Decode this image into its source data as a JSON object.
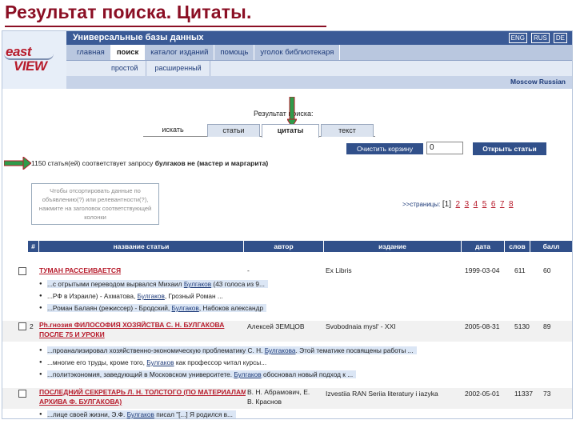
{
  "slide": {
    "title": "Результат поиска. Цитаты."
  },
  "site": {
    "title": "Универсальные базы данных",
    "logo_top": "east",
    "logo_bottom": "VIEW",
    "langs": [
      "ENG",
      "RUS",
      "DE"
    ],
    "nav": [
      "главная",
      "поиск",
      "каталог изданий",
      "помощь",
      "уголок библиотекаря"
    ],
    "active_nav": "поиск",
    "subnav": [
      "простой",
      "расширенный"
    ],
    "location": "Moscow Russian"
  },
  "search": {
    "result_heading": "Результат поиска:",
    "tabs": [
      "искать",
      "статьи",
      "цитаты",
      "текст"
    ],
    "active_tab": "цитаты",
    "clear_button": "Очистить корзину",
    "basket_count": "0",
    "open_button": "Открыть статьи",
    "found_text_prefix": "1150 статья(ей) соответствует запросу",
    "found_query": "булгаков не (мастер и маргарита)",
    "hint": "Чтобы отсортировать данные по объявлению(?) или релевантности(?), нажмите на заголовок соответствующей колонки",
    "pages_label": ">>страницы:",
    "current_page": "[1]",
    "pages": [
      "2",
      "3",
      "4",
      "5",
      "6",
      "7",
      "8"
    ]
  },
  "table": {
    "columns": [
      "#",
      "название статьи",
      "автор",
      "издание",
      "дата",
      "слов",
      "балл"
    ],
    "rows": [
      {
        "num": "",
        "title": "ТУМАН РАССЕИВАЕТСЯ",
        "author": "-",
        "source": "Ex Libris",
        "date": "1999-03-04",
        "words": "611",
        "score": "60",
        "snippets": [
          {
            "pre": "...с отрытыми переводом вырвался Михаил ",
            "kw": "Булгаков",
            "post": " (43 голоса из 9..."
          },
          {
            "pre": "...РФ в Израиле) - Ахматова, ",
            "kw": "Булгаков",
            "post": ", Грозный Роман ..."
          },
          {
            "pre": "...Роман Балаян (режиссер) - Бродский, ",
            "kw": "Булгаков",
            "post": ", Набоков александр"
          }
        ]
      },
      {
        "num": "2",
        "title": "Ph.гнозия ФИЛОСОФИЯ ХОЗЯЙСТВА С. Н. БУЛГАКОВА",
        "title2": "ПОСЛЕ 75 И УРОКИ",
        "author": "Алексей ЗЕМЦОВ",
        "source": "Svobodnaia mysl' - XXI",
        "date": "2005-08-31",
        "words": "5130",
        "score": "89",
        "snippets": [
          {
            "pre": "...проанализировал хозяйственно-экономическую проблематику С. Н. ",
            "kw": "Булгакова",
            "post": ". Этой тематике посвящены работы ..."
          },
          {
            "pre": "...многие его труды, кроме того, ",
            "kw": "Булгаков",
            "post": " как профессор читал курсы..."
          },
          {
            "pre": "...политэкономия, заведующий в Московском университете. ",
            "kw": "Булгаков",
            "post": " обосновал новый подход к ..."
          }
        ]
      },
      {
        "num": "",
        "title": "ПОСЛЕДНИЙ СЕКРЕТАРЬ Л. Н. ТОЛСТОГО (ПО МАТЕРИАЛАМ",
        "title2": "АРХИВА Ф. БУЛГАКОВА)",
        "author": "В. Н. Абрамович, Е.",
        "author2": "В. Краснов",
        "source": "Izvestiia RAN Seriia literatury i iazyka",
        "date": "2002-05-01",
        "words": "11337",
        "score": "73",
        "snippets": [
          {
            "pre": "...лице своей жизни, Э.Ф. ",
            "kw": "Булгаков",
            "post": " писал \"[...] Я родился в..."
          }
        ]
      }
    ]
  },
  "colors": {
    "accent": "#31508a",
    "title": "#8b0f24",
    "link": "#b71b2b",
    "arrow": "#2f9b4a"
  }
}
